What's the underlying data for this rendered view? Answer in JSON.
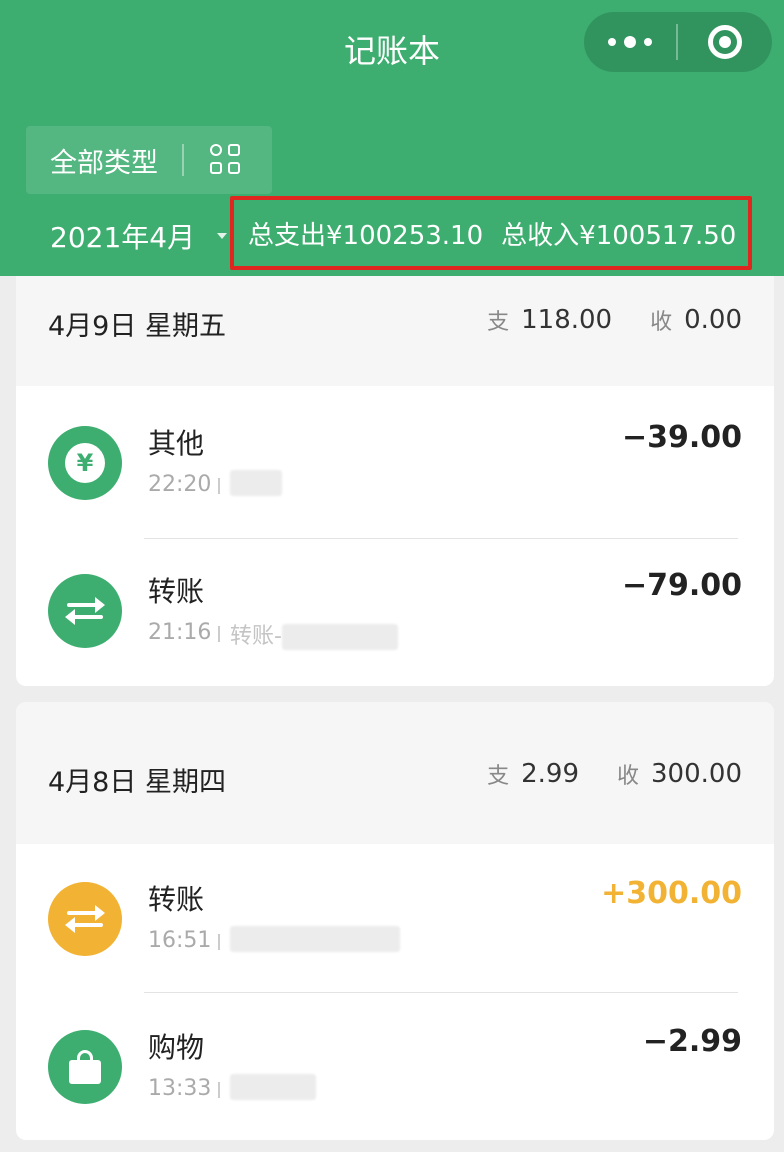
{
  "nav": {
    "title": "记账本"
  },
  "filter": {
    "type_label": "全部类型",
    "month": "2021年4月"
  },
  "summary": {
    "expense": "总支出¥100253.10",
    "income": "总收入¥100517.50"
  },
  "colors": {
    "brand_green": "#3dae70",
    "income_orange": "#f2b233",
    "highlight_red": "#e0271f"
  },
  "days": [
    {
      "date": "4月9日 星期五",
      "expense_tag": "支",
      "expense": "118.00",
      "income_tag": "收",
      "income": "0.00",
      "records": [
        {
          "category": "其他",
          "icon": "yen-icon",
          "time": "22:20",
          "note": "",
          "amount": "−39.00"
        },
        {
          "category": "转账",
          "icon": "transfer-icon",
          "time": "21:16",
          "note": "转账-",
          "amount": "−79.00"
        }
      ]
    },
    {
      "date": "4月8日 星期四",
      "expense_tag": "支",
      "expense": "2.99",
      "income_tag": "收",
      "income": "300.00",
      "records": [
        {
          "category": "转账",
          "icon": "transfer-icon",
          "time": "16:51",
          "note": "",
          "amount": "+300.00"
        },
        {
          "category": "购物",
          "icon": "bag-icon",
          "time": "13:33",
          "note": "",
          "amount": "−2.99"
        }
      ]
    }
  ]
}
